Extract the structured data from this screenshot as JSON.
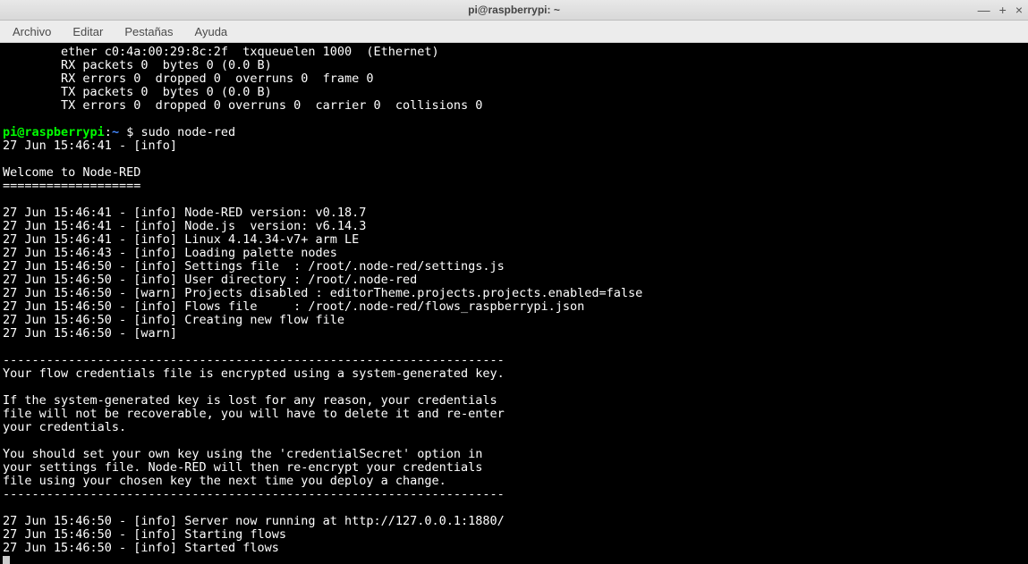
{
  "window": {
    "title": "pi@raspberrypi: ~"
  },
  "menu": {
    "archivo": "Archivo",
    "editar": "Editar",
    "pestanas": "Pestañas",
    "ayuda": "Ayuda"
  },
  "prompt": {
    "userhost": "pi@raspberrypi",
    "colon": ":",
    "path": "~ ",
    "dollar": "$",
    "command": " sudo node-red"
  },
  "pre_lines": [
    "        ether c0:4a:00:29:8c:2f  txqueuelen 1000  (Ethernet)",
    "        RX packets 0  bytes 0 (0.0 B)",
    "        RX errors 0  dropped 0  overruns 0  frame 0",
    "        TX packets 0  bytes 0 (0.0 B)",
    "        TX errors 0  dropped 0 overruns 0  carrier 0  collisions 0",
    ""
  ],
  "post_lines": [
    "27 Jun 15:46:41 - [info]",
    "",
    "Welcome to Node-RED",
    "===================",
    "",
    "27 Jun 15:46:41 - [info] Node-RED version: v0.18.7",
    "27 Jun 15:46:41 - [info] Node.js  version: v6.14.3",
    "27 Jun 15:46:41 - [info] Linux 4.14.34-v7+ arm LE",
    "27 Jun 15:46:43 - [info] Loading palette nodes",
    "27 Jun 15:46:50 - [info] Settings file  : /root/.node-red/settings.js",
    "27 Jun 15:46:50 - [info] User directory : /root/.node-red",
    "27 Jun 15:46:50 - [warn] Projects disabled : editorTheme.projects.projects.enabled=false",
    "27 Jun 15:46:50 - [info] Flows file     : /root/.node-red/flows_raspberrypi.json",
    "27 Jun 15:46:50 - [info] Creating new flow file",
    "27 Jun 15:46:50 - [warn]",
    "",
    "---------------------------------------------------------------------",
    "Your flow credentials file is encrypted using a system-generated key.",
    "",
    "If the system-generated key is lost for any reason, your credentials",
    "file will not be recoverable, you will have to delete it and re-enter",
    "your credentials.",
    "",
    "You should set your own key using the 'credentialSecret' option in",
    "your settings file. Node-RED will then re-encrypt your credentials",
    "file using your chosen key the next time you deploy a change.",
    "---------------------------------------------------------------------",
    "",
    "27 Jun 15:46:50 - [info] Server now running at http://127.0.0.1:1880/",
    "27 Jun 15:46:50 - [info] Starting flows",
    "27 Jun 15:46:50 - [info] Started flows"
  ]
}
